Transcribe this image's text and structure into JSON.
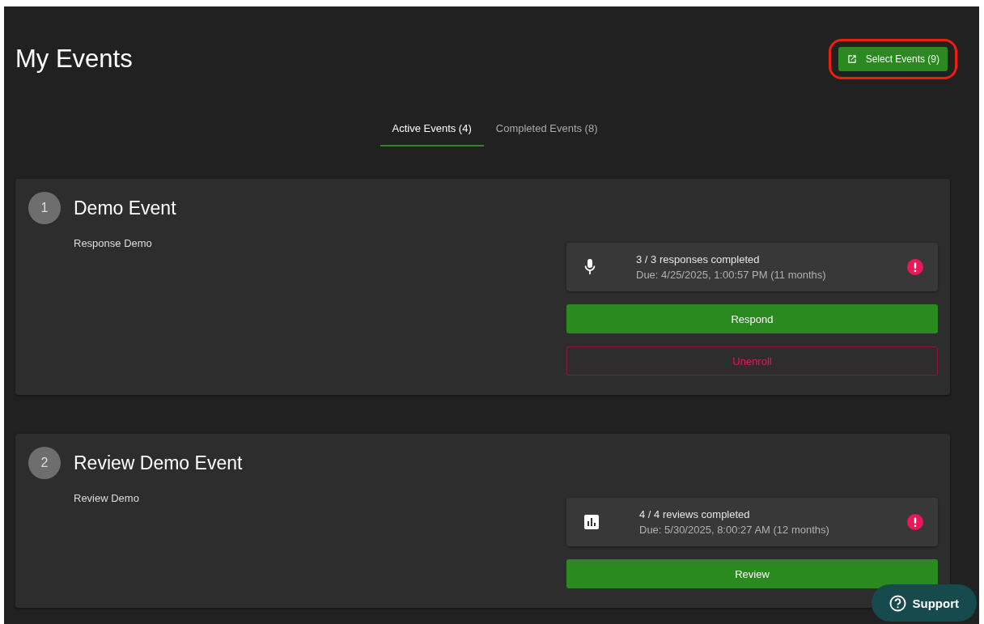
{
  "page": {
    "title": "My Events"
  },
  "select_button": {
    "label": "Select Events (9)",
    "highlighted": true
  },
  "tabs": [
    {
      "label": "Active Events (4)",
      "selected": true
    },
    {
      "label": "Completed Events (8)",
      "selected": false
    }
  ],
  "events": [
    {
      "number": "1",
      "title": "Demo Event",
      "subtitle": "Response Demo",
      "status": {
        "kind": "response",
        "progress": "3 / 3 responses completed",
        "due": "Due: 4/25/2025, 1:00:57 PM (11 months)",
        "alert": true
      },
      "actions": [
        {
          "kind": "primary",
          "label": "Respond"
        },
        {
          "kind": "danger",
          "label": "Unenroll"
        }
      ]
    },
    {
      "number": "2",
      "title": "Review Demo Event",
      "subtitle": "Review Demo",
      "status": {
        "kind": "review",
        "progress": "4 / 4 reviews completed",
        "due": "Due: 5/30/2025, 8:00:27 AM (12 months)",
        "alert": true
      },
      "actions": [
        {
          "kind": "primary",
          "label": "Review"
        }
      ]
    }
  ],
  "support_button": {
    "label": "Support"
  }
}
